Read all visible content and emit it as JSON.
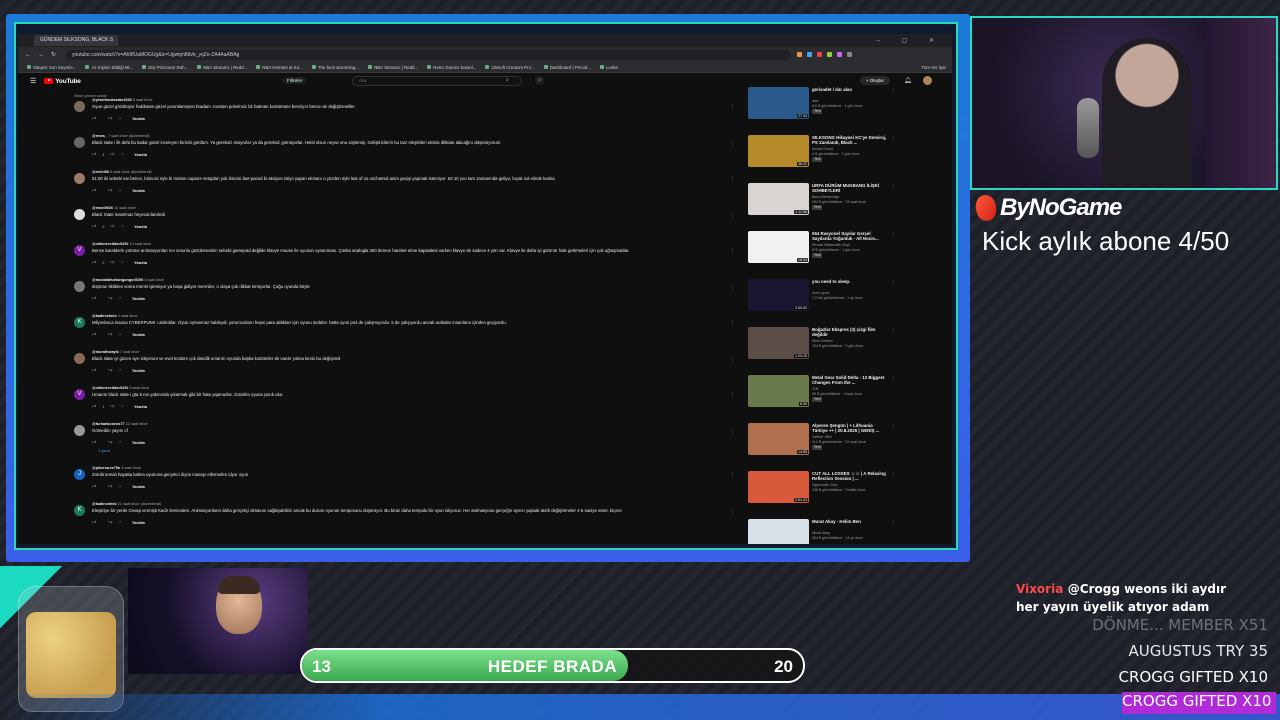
{
  "browser": {
    "tab_title": "GÜNDEM SILKSONG, BLACK S",
    "url": "youtube.com/watch?v=Ah9fUaMOGUg&lc=Ugwtyn8dvb_yqZe-ZA4AaABAg",
    "bookmarks": [
      "Sitepriz Son Seyrele...",
      "Az Kişinin Bildiği Mi...",
      "Dişi Prizsonar Rah...",
      "NBA Streams | Redd...",
      "NBA Hornets at Kn...",
      "The best streaming...",
      "NBA Streams | Redd...",
      "Retro Games Downl...",
      "Ubisoft Creators Pro...",
      "Dashboard | Precid...",
      "Lunkit"
    ],
    "bookmark_right": "Tüm Yer İşar"
  },
  "youtube": {
    "logo": "YouTube",
    "filters": "Filtreler",
    "search_placeholder": "Ara",
    "create": "+ Oluştur",
    "sort_note": "Önce yorum sırası"
  },
  "comments": [
    {
      "user": "@yesnfarukaslan4026",
      "time": "6 saat önce",
      "text": "Oyun güzel gözüküyor hakikaten güzel yorumlamışsın bradam. Kostüm pelerinsiz bir batman kostümüne benziyor bence de değiştirmeliler.",
      "likes": "",
      "color": "#7a6a5a",
      "initial": ""
    },
    {
      "user": "@rmea_",
      "time": "7 saat önce (düzenlendi)",
      "text": "Black state i ilk defa bu kadar güzel inceleyen birisini gördüm. Ya gereksiz övüyorlar ya da gereksiz gömüyorlar. Helal olsun neyse onu söylemiş. Geliştiricilerin bu tarz eleştirileri ekstra dikkate alacağını düşünüyorum.",
      "likes": "4",
      "color": "#666",
      "initial": ""
    },
    {
      "user": "@erchi06",
      "time": "6 saat önce (düzenlendi)",
      "text": "51:00 iki sebebi var bence, birincisi öyle bi motion capture setupları yok ikincisi fast-paced bi aksiyon istiyo yapan ekmanı o yüzden öyle last of us uncharted anim geçişi yapmak istemiyor. 52:10 yoo tam zamanında geliyo, bıçak sol elinde kanka",
      "likes": "",
      "color": "#9a7a6a",
      "initial": ""
    },
    {
      "user": "@reaei0926",
      "time": "10 saat önce",
      "text": "Black State inanılmaz heyecanlandırdı",
      "likes": "2",
      "color": "#ddd",
      "initial": ""
    },
    {
      "user": "@viktorreviktor0292",
      "time": "12 saat önce",
      "text": "Bence karakterin yürüme animasyonları nın sorunlu gözükmesinin sebebi gamepad değilde klavye mouse ile oyunun oynanması. Çünkü analogla 360 derece hareket etme kapasitesi varken klavye de sadece 4 yön var. Klavye ile daha iyi görünür hale getirmeleri için çok uğraşmalılar.",
      "likes": "2",
      "color": "#7b1fa2",
      "initial": "V"
    },
    {
      "user": "@mustafafurkangungor5196",
      "time": "8 saat önce",
      "text": "düşman tiktikten sonra mermi işlemiyor ya boşa gidiyor mermiler, o olaya çok dikkat etmiyorlar. Çoğu oyunda böyle",
      "likes": "",
      "color": "#777",
      "initial": ""
    },
    {
      "user": "@kadircelmis",
      "time": "4 saat önce",
      "text": "Milyonlarca insana CYBERPUNK ı aldırdılar. Oyun oynanmaz haldeydi. yorumcuların hepsi para aldıkları için oyunu övdüler. hatta oyun ps4 de çalışmıyordu. 5 de çalışıyordu ancak arabalar insanların içinden geçiyordu.",
      "likes": "",
      "color": "#1b7a5a",
      "initial": "K"
    },
    {
      "user": "@muratfurayik",
      "time": "7 saat önce",
      "text": "Black state iyi güzen ayrı istiyorum ve evet kostüm çok dandik umarım oyunda başka kostümler de vardır yoksa kesin bu değişmeli",
      "likes": "",
      "color": "#8a6a55",
      "initial": ""
    },
    {
      "user": "@viktorreviktor0292",
      "time": "9 saat önce",
      "text": "Umarım black state i gta 6 nın yakınında çıkarmak gibi bir hata yapmazlar. Güzelim oyuna yazık olur.",
      "likes": "1",
      "color": "#7b1fa2",
      "initial": "V"
    },
    {
      "user": "@furkankoseos77",
      "time": "22 saat önce",
      "text": "Gömedim yayını cf",
      "likes": "",
      "color": "#999",
      "initial": "",
      "replies": "1 yanıt"
    },
    {
      "user": "@jnkersa-ts79n",
      "time": "4 saat önce",
      "text": "Zombi temalı hayatta kalma oyununa gerçekci diyon masayı ellemeden idyor oyun",
      "likes": "",
      "color": "#1565c0",
      "initial": "J"
    },
    {
      "user": "@kadircelmis",
      "time": "21 saat önce (düzenlendi)",
      "text": "Eleştiriye bir yerde Cevap vermişti Kadir Denenden. Animasyonların daha gerçekçi olmasını sağlayabiliriz ancak bu durum oyunun temposunu düşürüyor. Bu biraz daha tempolu bir oyun istiyoruz. Her animasyonu gerçeğin aynısı yapsak atılıh değiştirmeler 4-5 saniye sürer. biçere",
      "likes": "",
      "color": "#1b7a5a",
      "initial": "K"
    }
  ],
  "comment_action": {
    "reply": "Yanıtla"
  },
  "sidebar": [
    {
      "title": "gerisadet / dar alan",
      "channel": "alan",
      "meta": "6,6 B görüntüleme · 1 gün önce",
      "badge": "Yeni",
      "dur": "27:34",
      "thumb": "#2b5a8a"
    },
    {
      "title": "SILKSONG Hikayesi KC'ye Demiroj, PS Zamlandı, Black ...",
      "channel": "Kemal Gürcü",
      "meta": "4 B görüntüleme · 1 gün önce",
      "badge": "Yeni",
      "dur": "36:22",
      "thumb": "#b48a2a"
    },
    {
      "title": "URFA DÜRÜM MUKBANG İLİŞKİ SOHBETLERİ",
      "channel": "Banu Bimbirmişa",
      "meta": "283 B görüntüleme · 23 saat önce",
      "badge": "Yeni",
      "dur": "1:11:56",
      "thumb": "#d8d4cf"
    },
    {
      "title": "064 Rasyonel Sayılar Gerçel Sayılarda Yoğunluk - All Nocin...",
      "channel": "Renale Matematik Köşü",
      "meta": "575 görüntüleme · 1 gün önce",
      "badge": "Yeni",
      "dur": "16:54",
      "thumb": "#f1f1f1"
    },
    {
      "title": "you need to sleep.",
      "channel": "tom's gone",
      "meta": "7,2 Mn görüntüleme · 1 ay önce",
      "badge": "",
      "dur": "3:00:00",
      "thumb": "#1a1530"
    },
    {
      "title": "Boğazlar Ekspres (3) çizgi film değildir",
      "channel": "Mind Vortekx",
      "meta": "704 B görüntüleme · 2 gün önce",
      "badge": "",
      "dur": "1:20:15",
      "thumb": "#5a4d45"
    },
    {
      "title": "Metal Gear Solid Delta - 12 Biggest Changes From the ...",
      "channel": "IGN",
      "meta": "95 B görüntüleme · 3 saat önce",
      "badge": "Yeni",
      "dur": "6:30",
      "thumb": "#6a7a4a"
    },
    {
      "title": "Alperen Şengün | + Lithuania Türkiye ++ | 20.8.2025 | GENİŞ ...",
      "channel": "Zaferer HBK",
      "meta": "113 B görüntüleme · 22 saat önce",
      "badge": "Yeni",
      "dur": "14:55",
      "thumb": "#b07050"
    },
    {
      "title": "CUT ALL LOSSES ☺☺ | A Relaxing Reflection Session | ...",
      "channel": "Hyperbolic Club",
      "meta": "198 B görüntüleme · 3 hafta önce",
      "badge": "",
      "dur": "2:01:23",
      "thumb": "#d85a3a"
    },
    {
      "title": "Murat Akay - Kelim Ben",
      "channel": "Murat Akay",
      "meta": "304 B görüntüleme · 14 yıl önce",
      "badge": "",
      "dur": "",
      "thumb": "#d8e0e8"
    }
  ],
  "overlay": {
    "brand": "ByNoGame",
    "kick_line": "Kick aylık abone 4/50",
    "goal": {
      "current": "13",
      "label": "HEDEF BRADA",
      "target": "20",
      "progress": 0.65
    },
    "chat": {
      "user": "Vixoria",
      "message": "@Crogg weons iki aydır her yayın üyelik atıyor adam"
    },
    "events": [
      "DÖNME... MEMBER X51",
      "AUGUSTUS  TRY 35",
      "CROGG  GIFTED X10",
      "CROGG  GIFTED X10"
    ]
  }
}
